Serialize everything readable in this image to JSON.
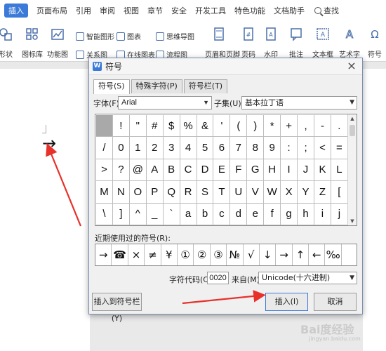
{
  "menubar": {
    "items": [
      "页面布局",
      "引用",
      "审阅",
      "视图",
      "章节",
      "安全",
      "开发工具",
      "特色功能",
      "文档助手"
    ],
    "active": "插入",
    "search_label": "查找"
  },
  "toolbar": {
    "shapes": "形状",
    "icon_lib": "图标库",
    "func_chart": "功能图",
    "smart_graphic": "智能图形",
    "chart": "图表",
    "mind_map": "思维导图",
    "relation": "关系图",
    "online_chart": "在线图表",
    "flowchart": "流程图",
    "header_footer": "页眉和页脚",
    "page_num": "页码",
    "watermark": "水印",
    "comment": "批注",
    "textbox": "文本框",
    "art_text": "艺术字",
    "symbol": "符号"
  },
  "dialog": {
    "title": "符号",
    "close": "×",
    "tabs": [
      "符号(S)",
      "特殊字符(P)",
      "符号栏(T)"
    ],
    "font_label": "字体(F):",
    "font_value": "Arial",
    "subset_label": "子集(U):",
    "subset_value": "基本拉丁语",
    "symbols": [
      [
        "",
        "!",
        "\"",
        "#",
        "$",
        "%",
        "&",
        "'",
        "(",
        ")",
        "*",
        "+",
        ",",
        "-",
        "."
      ],
      [
        "/",
        "0",
        "1",
        "2",
        "3",
        "4",
        "5",
        "6",
        "7",
        "8",
        "9",
        ":",
        ";",
        "<",
        "="
      ],
      [
        ">",
        "?",
        "@",
        "A",
        "B",
        "C",
        "D",
        "E",
        "F",
        "G",
        "H",
        "I",
        "J",
        "K",
        "L"
      ],
      [
        "M",
        "N",
        "O",
        "P",
        "Q",
        "R",
        "S",
        "T",
        "U",
        "V",
        "W",
        "X",
        "Y",
        "Z",
        "["
      ],
      [
        "\\",
        "]",
        "^",
        "_",
        "`",
        "a",
        "b",
        "c",
        "d",
        "e",
        "f",
        "g",
        "h",
        "i",
        "j"
      ]
    ],
    "recent_label": "近期使用过的符号(R):",
    "recent": [
      "→",
      "☎",
      "×",
      "≠",
      "¥",
      "①",
      "②",
      "③",
      "№",
      "√",
      "↓",
      "→",
      "↑",
      "←",
      "‰"
    ],
    "code_label": "字符代码(C):",
    "code_value": "0020",
    "from_label": "来自(M)",
    "from_value": "Unicode(十六进制)",
    "btn_insert_bar": "插入到符号栏(Y)",
    "btn_insert": "插入(I)",
    "btn_cancel": "取消"
  },
  "document": {
    "inserted_symbol": "→"
  },
  "watermark": {
    "main": "Bai度经验",
    "sub": "jingyan.baidu.com"
  }
}
